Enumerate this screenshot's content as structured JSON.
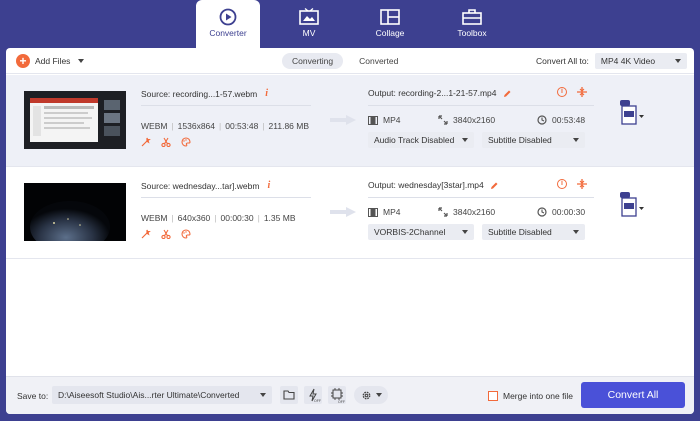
{
  "nav": {
    "tabs": [
      {
        "label": "Converter",
        "icon": "converter-icon",
        "active": true
      },
      {
        "label": "MV",
        "icon": "mv-icon"
      },
      {
        "label": "Collage",
        "icon": "collage-icon"
      },
      {
        "label": "Toolbox",
        "icon": "toolbox-icon"
      }
    ]
  },
  "toolbar": {
    "add_files_label": "Add Files",
    "tabs": [
      "Converting",
      "Converted"
    ],
    "convert_all_label": "Convert All to:",
    "convert_all_value": "MP4 4K Video"
  },
  "files": [
    {
      "source": "Source: recording...1-57.webm",
      "format": "WEBM",
      "resolution": "1536x864",
      "duration": "00:53:48",
      "size": "211.86 MB",
      "output": "Output: recording-2...1-21-57.mp4",
      "out_format": "MP4",
      "out_resolution": "3840x2160",
      "out_duration": "00:53:48",
      "audio": "Audio Track Disabled",
      "subtitle": "Subtitle Disabled"
    },
    {
      "source": "Source: wednesday...tar].webm",
      "format": "WEBM",
      "resolution": "640x360",
      "duration": "00:00:30",
      "size": "1.35 MB",
      "output": "Output: wednesday[3star].mp4",
      "out_format": "MP4",
      "out_resolution": "3840x2160",
      "out_duration": "00:00:30",
      "audio": "VORBIS-2Channel",
      "subtitle": "Subtitle Disabled"
    }
  ],
  "bottom": {
    "save_to_label": "Save to:",
    "path": "D:\\Aiseesoft Studio\\Ais...rter Ultimate\\Converted",
    "merge_label": "Merge into one file",
    "convert_button": "Convert All"
  },
  "colors": {
    "accent": "#f26a3b",
    "primary": "#4a51d8",
    "frame": "#3d4090"
  }
}
